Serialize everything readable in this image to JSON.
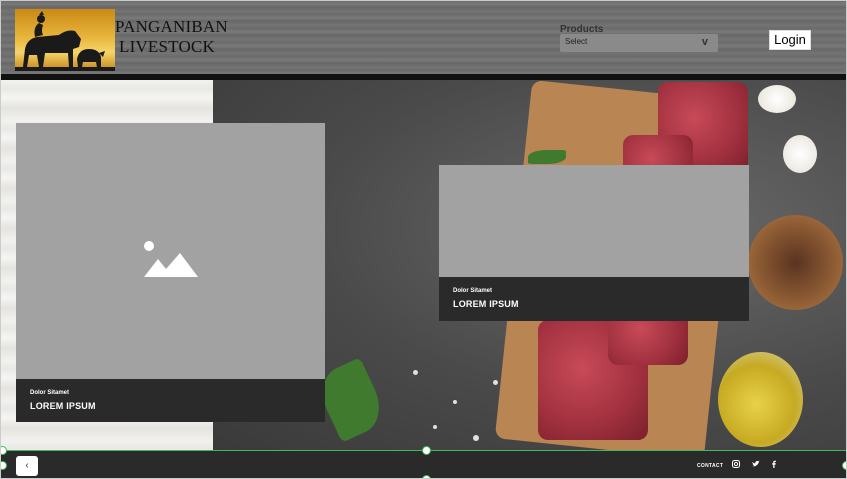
{
  "header": {
    "brand_line1": "PANGANIBAN",
    "brand_line2": "LIVESTOCK",
    "products_label": "Products",
    "products_select_value": "Select",
    "login_label": "Login"
  },
  "cards": [
    {
      "subtitle": "Dolor Sitamet",
      "title": "LOREM IPSUM"
    },
    {
      "subtitle": "Dolor Sitamet",
      "title": "LOREM IPSUM"
    }
  ],
  "footer": {
    "back_label": "‹",
    "contact_label": "CONTACT",
    "social_icons": [
      "instagram-icon",
      "twitter-icon",
      "facebook-icon"
    ]
  },
  "colors": {
    "header_bg": "#6e6e6e",
    "card_bg": "#a2a2a2",
    "caption_bg": "#2a2a2a",
    "footer_bg": "#2a2a2a",
    "selection_accent": "#3dbb5a"
  }
}
